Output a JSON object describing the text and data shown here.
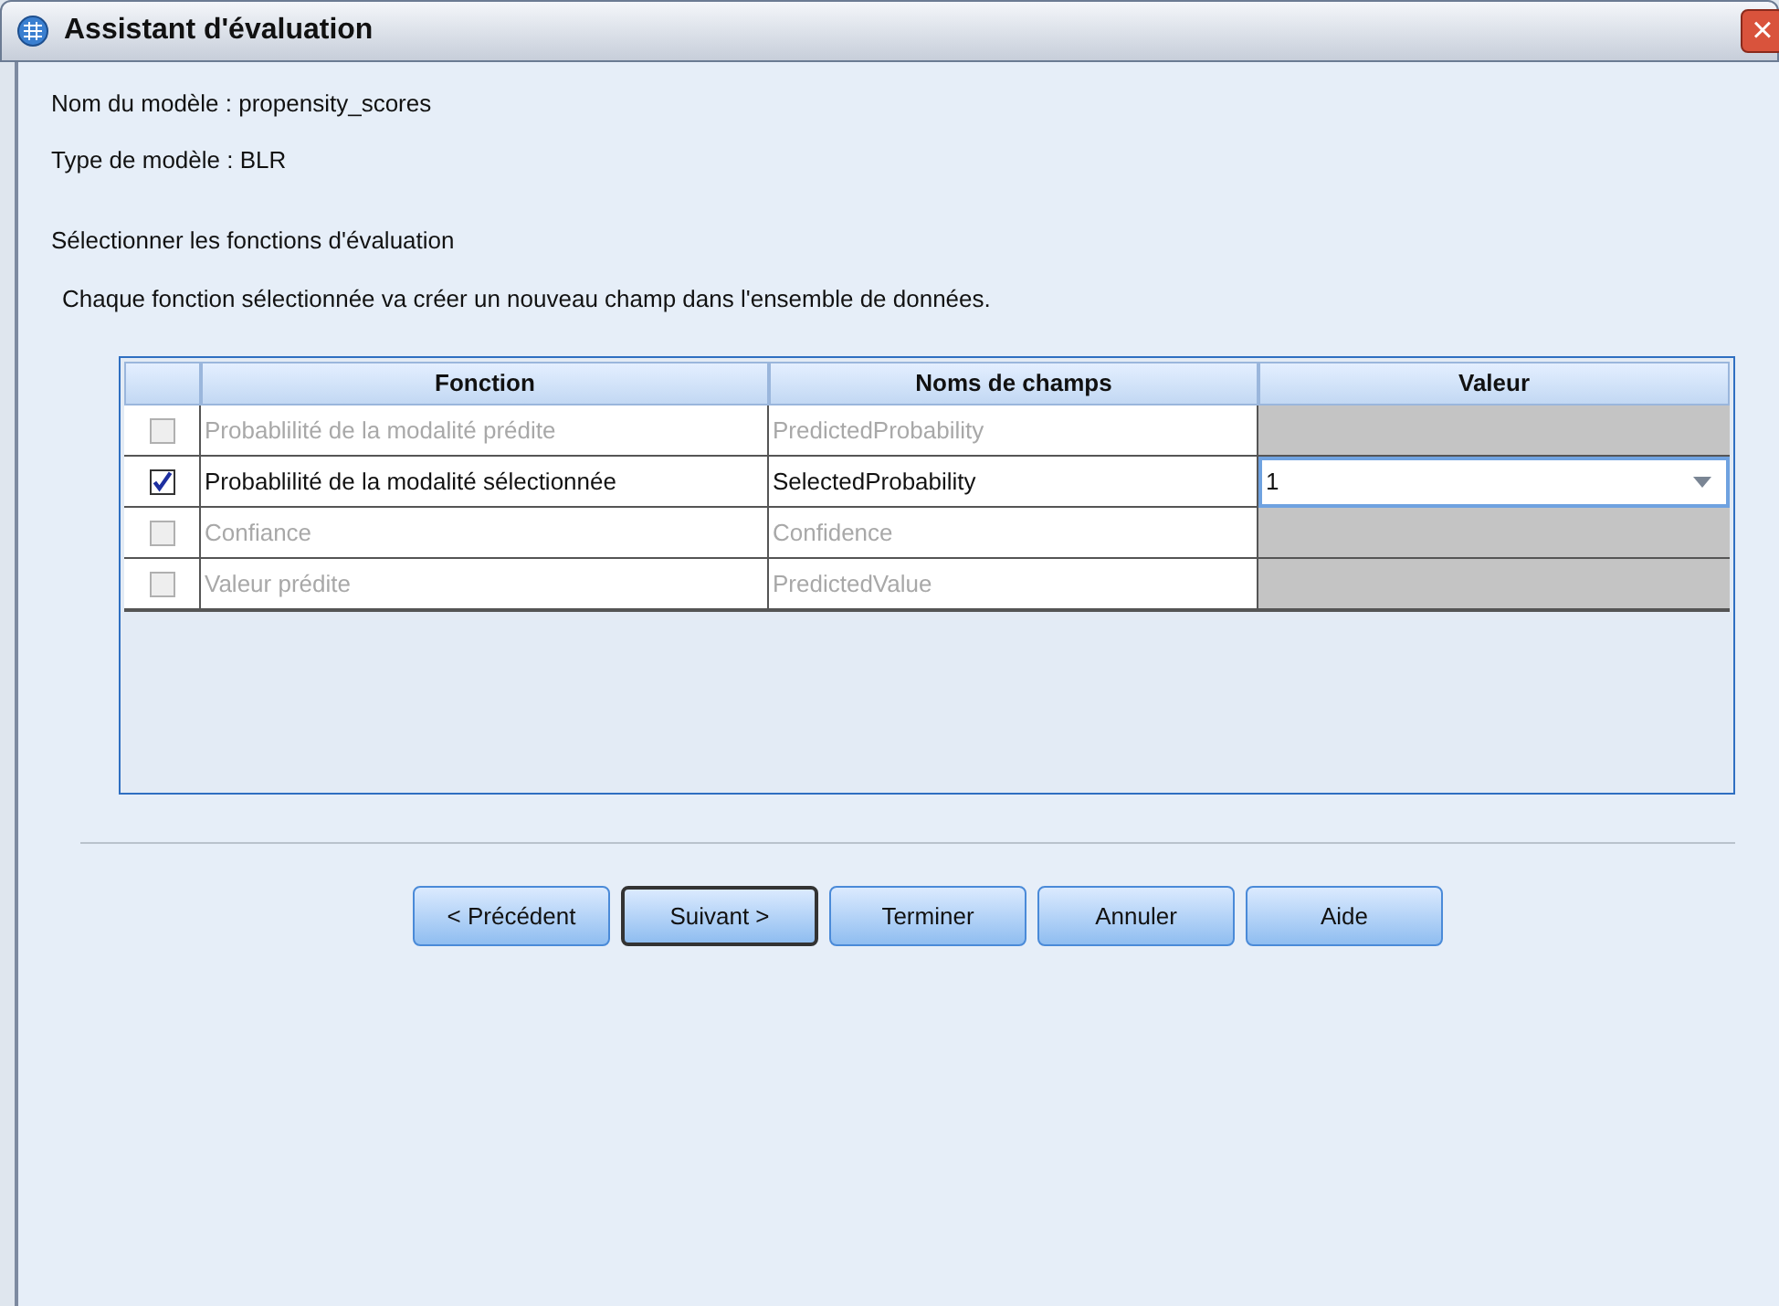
{
  "window": {
    "title": "Assistant d'évaluation",
    "close": "×"
  },
  "model_name": "Nom du modèle : propensity_scores",
  "model_type": "Type de modèle : BLR",
  "section_label": "Sélectionner les fonctions d'évaluation",
  "section_hint": "Chaque fonction sélectionnée va créer un nouveau champ dans l'ensemble de données.",
  "table": {
    "columns": [
      "Fonction",
      "Noms de champs",
      "Valeur"
    ],
    "rows": [
      {
        "checked": false,
        "function": "Probablilité de la modalité prédite",
        "field": "PredictedProbability"
      },
      {
        "checked": true,
        "function": "Probablilité de la modalité sélectionnée",
        "field": "SelectedProbability",
        "value": "1"
      },
      {
        "checked": false,
        "function": "Confiance",
        "field": "Confidence"
      },
      {
        "checked": false,
        "function": "Valeur prédite",
        "field": "PredictedValue"
      }
    ]
  },
  "buttons": [
    {
      "label": "< Précédent",
      "focused": false
    },
    {
      "label": "Suivant >",
      "focused": true
    },
    {
      "label": "Terminer",
      "focused": false
    },
    {
      "label": "Annuler",
      "focused": false
    },
    {
      "label": "Aide",
      "focused": false
    }
  ]
}
